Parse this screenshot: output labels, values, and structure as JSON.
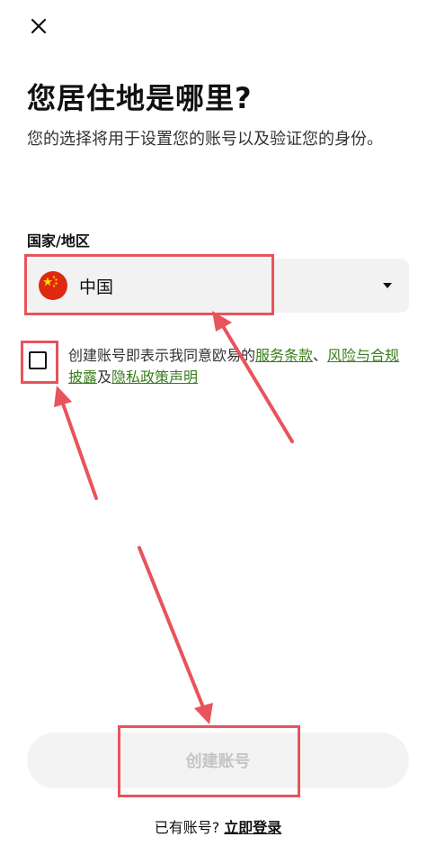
{
  "header": {
    "close_icon": "close-icon"
  },
  "main": {
    "title": "您居住地是哪里?",
    "subtitle": "您的选择将用于设置您的账号以及验证您的身份。"
  },
  "region": {
    "label": "国家/地区",
    "selected_country": "中国",
    "flag_icon": "china-flag-icon",
    "dropdown_icon": "caret-down-icon"
  },
  "consent": {
    "checked": false,
    "prefix": "创建账号即表示我同意欧易的",
    "terms_link": "服务条款",
    "separator": "、",
    "risk_link": "风险与合规披露",
    "conjunction": "及",
    "privacy_link": "隐私政策声明"
  },
  "actions": {
    "create_account_label": "创建账号",
    "has_account_text": "已有账号?",
    "login_link": "立即登录"
  },
  "colors": {
    "link": "#3a7d1d",
    "annotation": "#e8535c",
    "disabled_button_bg": "#f3f3f3",
    "disabled_button_text": "#c4c4c4",
    "flag_red": "#de2910",
    "flag_yellow": "#ffde00"
  }
}
